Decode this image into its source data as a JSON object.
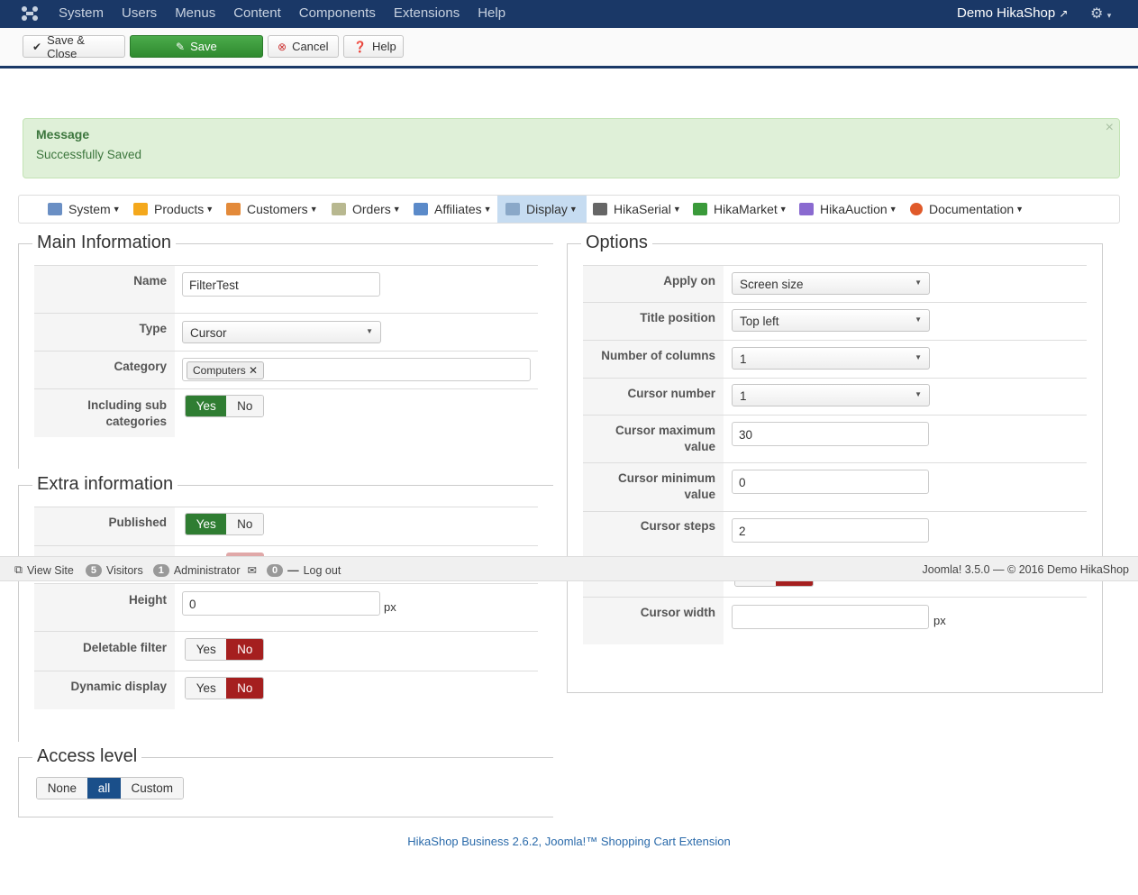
{
  "topbar": {
    "menu": [
      "System",
      "Users",
      "Menus",
      "Content",
      "Components",
      "Extensions",
      "Help"
    ],
    "site_name": "Demo HikaShop"
  },
  "toolbar": {
    "save_close": "Save & Close",
    "save": "Save",
    "cancel": "Cancel",
    "help": "Help"
  },
  "message": {
    "heading": "Message",
    "text": "Successfully Saved"
  },
  "hika_nav": [
    "System",
    "Products",
    "Customers",
    "Orders",
    "Affiliates",
    "Display",
    "HikaSerial",
    "HikaMarket",
    "HikaAuction",
    "Documentation"
  ],
  "main_info": {
    "legend": "Main Information",
    "name_label": "Name",
    "name_value": "FilterTest",
    "type_label": "Type",
    "type_value": "Cursor",
    "category_label": "Category",
    "category_tag": "Computers",
    "sub_label_1": "Including sub",
    "sub_label_2": "categories",
    "yes": "Yes",
    "no": "No"
  },
  "extra_info": {
    "legend": "Extra information",
    "published_label": "Published",
    "height_label": "Height",
    "height_value": "0",
    "unit": "px",
    "deletable_label": "Deletable filter",
    "dynamic_label": "Dynamic display"
  },
  "access": {
    "legend": "Access level",
    "none": "None",
    "all": "all",
    "custom": "Custom"
  },
  "options": {
    "legend": "Options",
    "apply_on_label": "Apply on",
    "apply_on_value": "Screen size",
    "title_pos_label": "Title position",
    "title_pos_value": "Top left",
    "columns_label": "Number of columns",
    "columns_value": "1",
    "cursor_number_label": "Cursor number",
    "cursor_number_value": "1",
    "cursor_max_label_1": "Cursor maximum",
    "cursor_max_label_2": "value",
    "cursor_max_value": "30",
    "cursor_min_label_1": "Cursor minimum",
    "cursor_min_label_2": "value",
    "cursor_min_value": "0",
    "cursor_steps_label": "Cursor steps",
    "cursor_steps_value": "2",
    "cursor_width_label": "Cursor width",
    "cursor_width_value": "",
    "unit": "px"
  },
  "statusbar": {
    "view_site": "View Site",
    "visitors_count": "5",
    "visitors": "Visitors",
    "admin_count": "1",
    "admin": "Administrator",
    "msg_count": "0",
    "logout": "Log out",
    "right": "Joomla! 3.5.0  —  © 2016 Demo HikaShop"
  },
  "footer": "HikaShop Business 2.6.2, Joomla!™ Shopping Cart Extension"
}
